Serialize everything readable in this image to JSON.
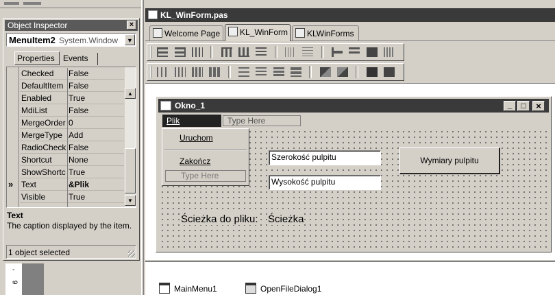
{
  "object_inspector": {
    "title": "Object Inspector",
    "selected_component": "MenuItem2",
    "selected_type": "System.Window",
    "tabs": [
      {
        "label": "Properties"
      },
      {
        "label": "Events"
      }
    ],
    "properties": [
      {
        "name": "Checked",
        "value": "False"
      },
      {
        "name": "DefaultItem",
        "value": "False"
      },
      {
        "name": "Enabled",
        "value": "True"
      },
      {
        "name": "MdiList",
        "value": "False"
      },
      {
        "name": "MergeOrder",
        "value": "0"
      },
      {
        "name": "MergeType",
        "value": "Add"
      },
      {
        "name": "RadioCheck",
        "value": "False"
      },
      {
        "name": "Shortcut",
        "value": "None"
      },
      {
        "name": "ShowShortc",
        "value": "True"
      },
      {
        "name": "Text",
        "value": "&Plik"
      },
      {
        "name": "Visible",
        "value": "True"
      }
    ],
    "selected_row_marker": "»",
    "help_title": "Text",
    "help_text": "The caption displayed by the item.",
    "status": "1 object selected"
  },
  "side_ruler": {
    "tick1": "-",
    "tick2": "9"
  },
  "editor": {
    "title": "KL_WinForm.pas",
    "tabs": [
      {
        "label": "Welcome Page"
      },
      {
        "label": "KL_WinForm"
      },
      {
        "label": "KLWinForms"
      }
    ]
  },
  "form": {
    "title": "Okno_1",
    "window_buttons": {
      "minimize": "_",
      "maximize": "□",
      "close": "×"
    },
    "menu_bar": {
      "item": "Plik",
      "type_here": "Type Here"
    },
    "dropdown": {
      "items": [
        {
          "label": "Uruchom"
        },
        {
          "label": "Zakończ"
        }
      ],
      "type_here": "Type Here"
    },
    "width_box": "Szerokość pulpitu",
    "height_box": "Wysokość pulpitu",
    "dims_button": "Wymiary pulpitu",
    "path_label": "Ścieżka do pliku:",
    "path_value": "Ścieżka"
  },
  "components_tray": [
    {
      "label": "MainMenu1"
    },
    {
      "label": "OpenFileDialog1"
    }
  ]
}
